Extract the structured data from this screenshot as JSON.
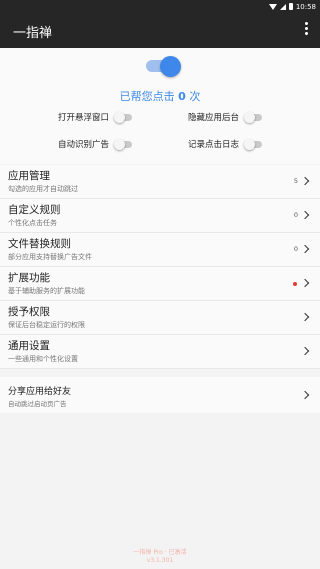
{
  "status_bar": {
    "time": "10:58"
  },
  "app_bar": {
    "title": "一指禅",
    "menu_icon": "overflow-menu-icon"
  },
  "main_switch": {
    "on": true,
    "accent_color": "#3f87ea"
  },
  "click_count": {
    "prefix": "已帮您点击",
    "count": "0",
    "suffix": "次"
  },
  "options": [
    {
      "label": "打开悬浮窗口",
      "on": false
    },
    {
      "label": "隐藏应用后台",
      "on": false
    },
    {
      "label": "自动识别广告",
      "on": false
    },
    {
      "label": "记录点击日志",
      "on": false
    }
  ],
  "menu": [
    {
      "title": "应用管理",
      "subtitle": "勾选的应用才自动跳过",
      "badge": "5"
    },
    {
      "title": "自定义规则",
      "subtitle": "个性化点击任务",
      "badge": "0"
    },
    {
      "title": "文件替换规则",
      "subtitle": "部分应用支持替换广告文件",
      "badge": "0"
    },
    {
      "title": "扩展功能",
      "subtitle": "基于辅助服务的扩展功能",
      "badge": "",
      "dot_color": "#e53935"
    },
    {
      "title": "授予权限",
      "subtitle": "保证后台稳定运行的权限",
      "badge": ""
    },
    {
      "title": "通用设置",
      "subtitle": "一些通用和个性化设置",
      "badge": ""
    }
  ],
  "share": {
    "title": "分享应用给好友",
    "subtitle": "自动跳过启动页广告"
  },
  "footer": {
    "line1": "一指禅 Pro · 已激活",
    "line2": "v3.1.301"
  }
}
